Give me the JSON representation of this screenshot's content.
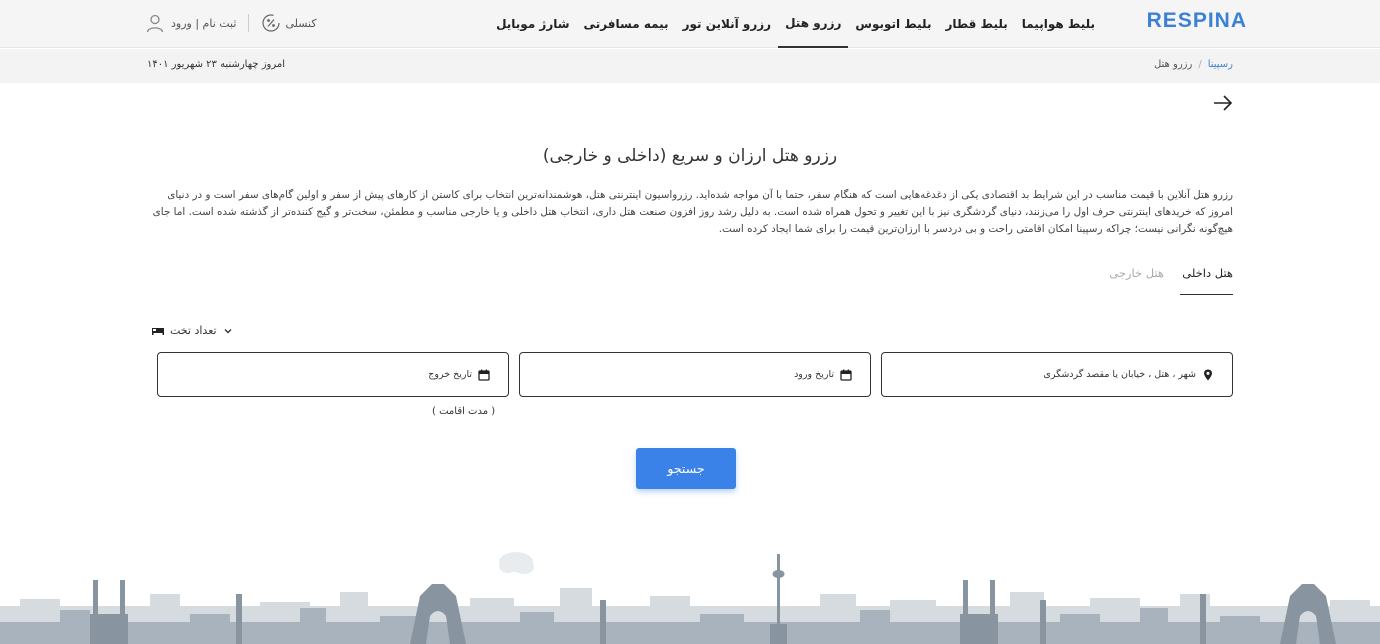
{
  "header": {
    "logo": "RESPINA",
    "nav": [
      "بلیط هواپیما",
      "بلیط قطار",
      "بلیط اتوبوس",
      "رزرو هتل",
      "رزرو آنلاین تور",
      "بیمه مسافرتی",
      "شارژ موبایل"
    ],
    "active_nav": "رزرو هتل",
    "discount_label": "کنسلی",
    "auth_label": "ثبت نام | ورود"
  },
  "breadcrumb": {
    "home": "رسپینا",
    "separator": "/",
    "current": "رزرو هتل"
  },
  "today": "امروز چهارشنبه ۲۳ شهریور ۱۴۰۱",
  "page": {
    "title": "رزرو هتل ارزان و سریع (داخلی و خارجی)",
    "description": "رزرو هتل آنلاین با قیمت مناسب در این شرایط بد اقتصادی یکی از دغدغه‌هایی است که هنگام سفر، حتما با آن مواجه شده‌اید. رزرواسیون اینترنتی هتل، هوشمندانه‌ترین انتخاب برای کاستن از کارهای پیش از سفر و اولین گام‌های سفر است و در دنیای امروز که خریدهای اینترنتی حرف اول را می‌زنند، دنیای گردشگری نیز با این تغییر و تحول همراه شده است. به دلیل رشد روز افزون صنعت هتل داری، انتخاب هتل داخلی و یا خارجی مناسب و مطمئن، سخت‌تر و گیج کننده‌تر از گذشته شده است. اما جای هیچ‌گونه نگرانی نیست؛ چراکه رسپینا امکان اقامتی راحت و بی دردسر با ارزان‌ترین قیمت را برای شما ایجاد کرده است."
  },
  "tabs": {
    "domestic": "هتل داخلی",
    "foreign": "هتل خارجی",
    "active": "domestic"
  },
  "form": {
    "beds_label": "تعداد تخت",
    "destination_placeholder": "شهر ، هتل ، خیابان یا مقصد گردشگری",
    "checkin_placeholder": "تاریخ ورود",
    "checkout_placeholder": "تاریخ خروج",
    "stay_duration": "( مدت اقامت )",
    "search_label": "جستجو"
  },
  "colors": {
    "brand": "#3b82d6",
    "button": "#3b82e8"
  }
}
